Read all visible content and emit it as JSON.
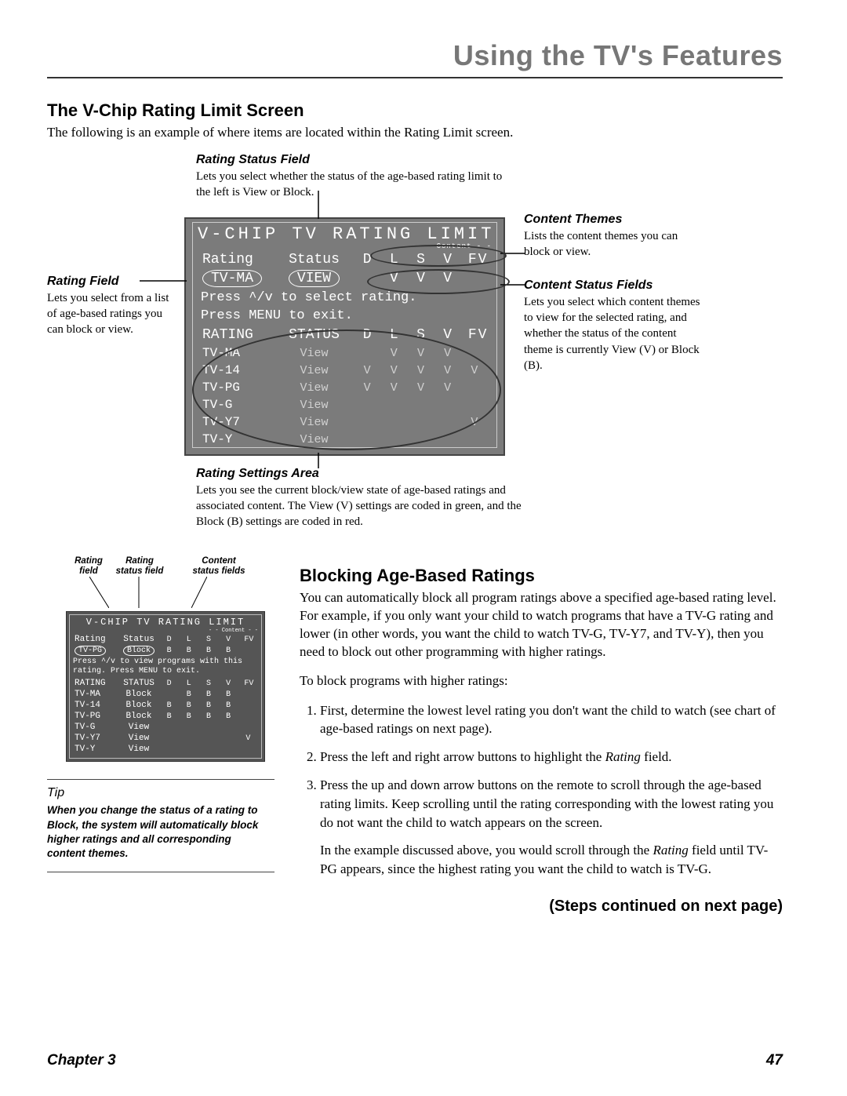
{
  "header": {
    "title": "Using the TV's Features"
  },
  "section1": {
    "heading": "The V-Chip Rating Limit Screen",
    "intro": "The following is an example of where items are located within the Rating Limit screen."
  },
  "annot": {
    "top": {
      "heading": "Rating Status Field",
      "text": "Lets you select whether the status of the age-based rating limit to the left is View or Block."
    },
    "left": {
      "heading": "Rating Field",
      "text": "Lets you select from a list of age-based ratings you can block or view."
    },
    "right1": {
      "heading": "Content Themes",
      "text": "Lists the content themes you can block or view."
    },
    "right2": {
      "heading": "Content Status Fields",
      "text": "Lets you select which content themes to view for the selected rating, and whether the status of the content theme is currently View (V) or Block (B)."
    },
    "bottom": {
      "heading": "Rating Settings Area",
      "text": "Lets you see the current block/view state of age-based ratings and associated content. The View (V) settings are coded in green, and the Block (B) settings are coded in red."
    }
  },
  "osd": {
    "title": "V-CHIP TV RATING LIMIT",
    "content_divider": "- - Content - -",
    "hdr_rating": "Rating",
    "hdr_status": "Status",
    "ct_cols": [
      "D",
      "L",
      "S",
      "V",
      "FV"
    ],
    "sel_rating": "TV-MA",
    "sel_status": "VIEW",
    "sel_ct": [
      "",
      "V",
      "V",
      "V",
      ""
    ],
    "instr1": "Press ^/v to select rating.",
    "instr2": "Press MENU to exit.",
    "list_hdr_rating": "RATING",
    "list_hdr_status": "STATUS",
    "rows": [
      {
        "r": "TV-MA",
        "s": "View",
        "c": [
          "",
          "V",
          "V",
          "V",
          ""
        ]
      },
      {
        "r": "TV-14",
        "s": "View",
        "c": [
          "V",
          "V",
          "V",
          "V",
          "V"
        ]
      },
      {
        "r": "TV-PG",
        "s": "View",
        "c": [
          "V",
          "V",
          "V",
          "V",
          ""
        ]
      },
      {
        "r": "TV-G",
        "s": "View",
        "c": [
          "",
          "",
          "",
          "",
          ""
        ]
      },
      {
        "r": "TV-Y7",
        "s": "View",
        "c": [
          "",
          "",
          "",
          "",
          "V"
        ]
      },
      {
        "r": "TV-Y",
        "s": "View",
        "c": [
          "",
          "",
          "",
          "",
          ""
        ]
      }
    ]
  },
  "mini_labels": {
    "c1a": "Rating",
    "c1b": "field",
    "c2a": "Rating",
    "c2b": "status field",
    "c3a": "Content",
    "c3b": "status fields"
  },
  "mini_osd": {
    "title": "V-CHIP TV RATING LIMIT",
    "content_divider": "- - Content - -",
    "hdr_rating": "Rating",
    "hdr_status": "Status",
    "ct_cols": [
      "D",
      "L",
      "S",
      "V",
      "FV"
    ],
    "sel_rating": "TV-PG",
    "sel_status": "Block",
    "sel_ct": [
      "B",
      "B",
      "B",
      "B",
      ""
    ],
    "instr": "Press ^/v to view programs with this rating. Press MENU to exit.",
    "list_hdr_rating": "RATING",
    "list_hdr_status": "STATUS",
    "rows": [
      {
        "r": "TV-MA",
        "s": "Block",
        "c": [
          "",
          "B",
          "B",
          "B",
          ""
        ]
      },
      {
        "r": "TV-14",
        "s": "Block",
        "c": [
          "B",
          "B",
          "B",
          "B",
          ""
        ]
      },
      {
        "r": "TV-PG",
        "s": "Block",
        "c": [
          "B",
          "B",
          "B",
          "B",
          ""
        ]
      },
      {
        "r": "TV-G",
        "s": "View",
        "c": [
          "",
          "",
          "",
          "",
          ""
        ]
      },
      {
        "r": "TV-Y7",
        "s": "View",
        "c": [
          "",
          "",
          "",
          "",
          "V"
        ]
      },
      {
        "r": "TV-Y",
        "s": "View",
        "c": [
          "",
          "",
          "",
          "",
          ""
        ]
      }
    ]
  },
  "tip": {
    "heading": "Tip",
    "text": "When you change the status of a rating to Block, the system will automatically block higher ratings and all corresponding content themes."
  },
  "section2": {
    "heading": "Blocking Age-Based Ratings",
    "p1": "You can automatically block all program ratings above a specified age-based rating level. For example, if you only want your child to watch programs that have a TV-G rating and lower (in other words, you want the child to watch TV-G, TV-Y7, and TV-Y), then you need to block out other programming with higher ratings.",
    "p2": "To block programs with higher ratings:",
    "steps": [
      "First, determine the lowest level rating you don't want the child to watch (see chart of age-based ratings on next page).",
      "Press the left and right arrow buttons to highlight the Rating field.",
      "Press the up and down arrow buttons on the remote to scroll through the age-based rating limits. Keep scrolling until the rating corresponding with the lowest rating you do not want the child to watch appears on the screen."
    ],
    "example": "In the example discussed above, you would scroll through the Rating field until TV-PG appears, since the highest rating you want the child to watch is TV-G.",
    "continued": "(Steps continued on next page)",
    "rating_word": "Rating"
  },
  "footer": {
    "chapter": "Chapter 3",
    "page": "47"
  }
}
